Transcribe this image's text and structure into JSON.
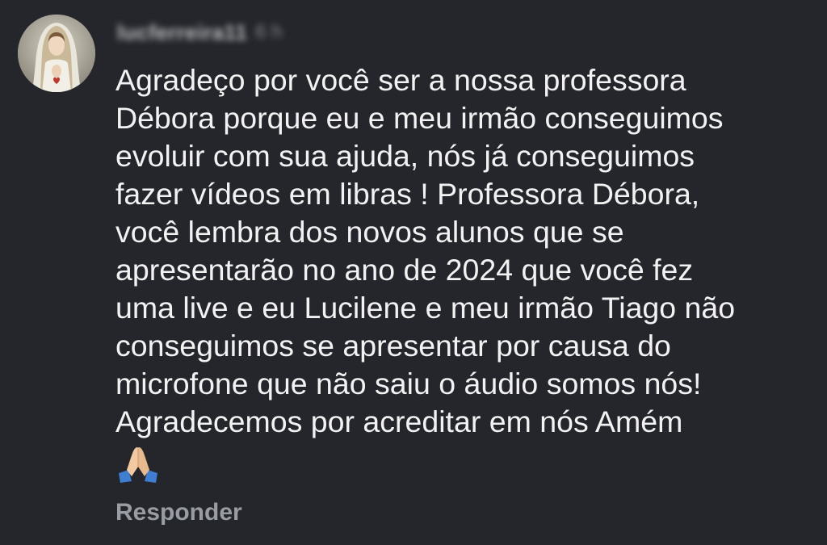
{
  "comment": {
    "username": "lucferreira11",
    "timestamp": "6 h",
    "text": "Agradeço por você ser a nossa professora\nDébora porque eu e meu irmão conseguimos\nevoluir com sua ajuda, nós já conseguimos\nfazer vídeos em libras ! Professora Débora,\nvocê lembra dos novos alunos que se\napresentarão no ano de 2024 que você fez\numa live e eu Lucilene e meu irmão Tiago não\nconseguimos se apresentar por causa do\nmicrofone que não saiu o áudio somos nós!\nAgradecemos por acreditar em nós Amém",
    "emoji": "🙏🏼",
    "emoji_icon": "praying-hands-icon",
    "reply_label": "Responder"
  },
  "colors": {
    "background": "#24262c",
    "text": "#f2f2f2",
    "muted": "#9a9ca3"
  }
}
